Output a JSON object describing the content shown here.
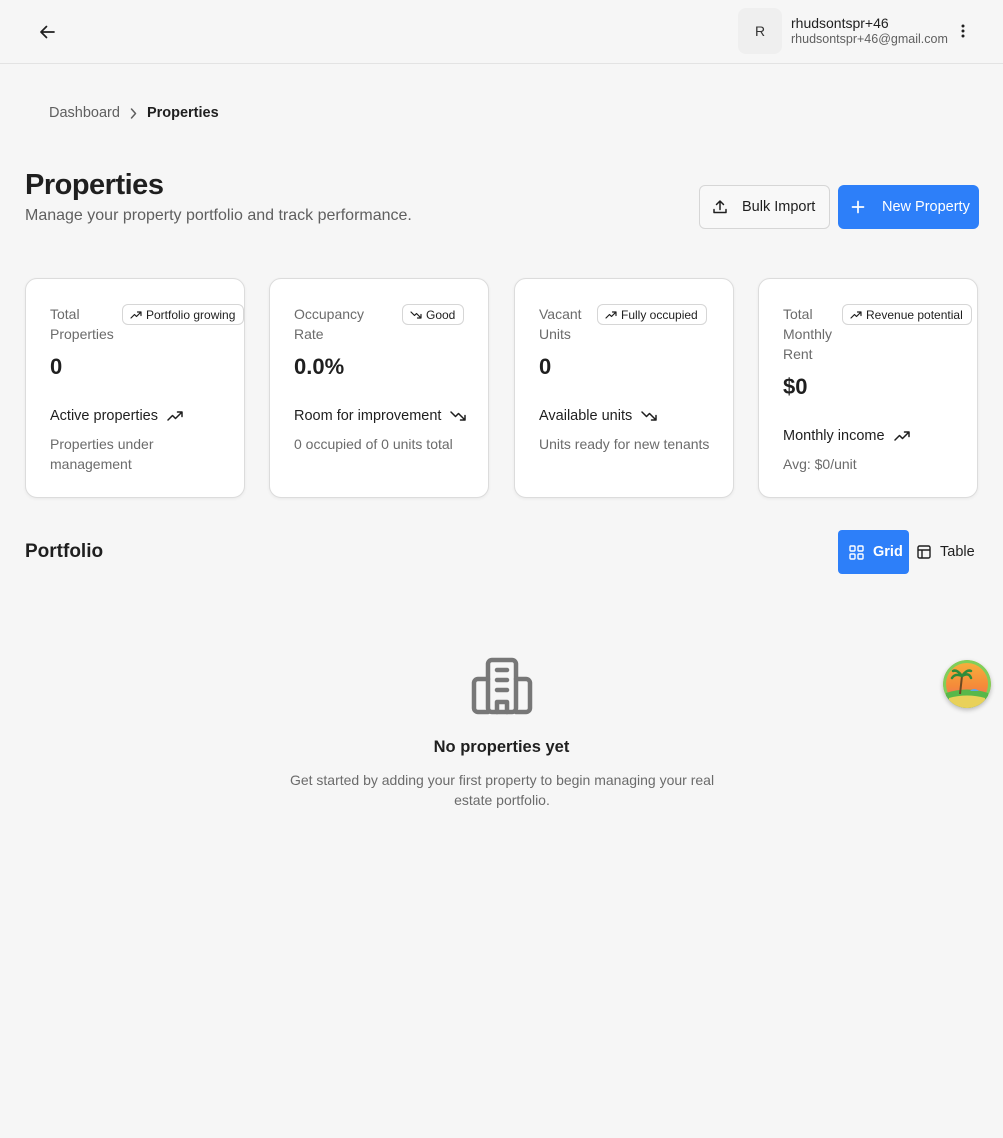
{
  "header": {
    "avatar_initial": "R",
    "user_name": "rhudsontspr+46",
    "user_email": "rhudsontspr+46@gmail.com"
  },
  "breadcrumb": {
    "parent": "Dashboard",
    "current": "Properties"
  },
  "page": {
    "title": "Properties",
    "subtitle": "Manage your property portfolio and track performance."
  },
  "actions": {
    "bulk_import": "Bulk Import",
    "new_property": "New Property"
  },
  "stats": [
    {
      "label_lines": [
        "Total",
        "Properties"
      ],
      "badge": "Portfolio growing",
      "badge_trend": "up",
      "value": "0",
      "footer": "Active properties",
      "footer_trend": "up",
      "sub_lines": [
        "Properties under",
        "management"
      ]
    },
    {
      "label_lines": [
        "Occupancy",
        "Rate"
      ],
      "badge": "Good",
      "badge_trend": "down",
      "value": "0.0%",
      "footer": "Room for improvement",
      "footer_trend": "down",
      "sub_lines": [
        "0 occupied of 0 units total"
      ]
    },
    {
      "label_lines": [
        "Vacant",
        "Units"
      ],
      "badge": "Fully occupied",
      "badge_trend": "up",
      "value": "0",
      "footer": "Available units",
      "footer_trend": "down",
      "sub_lines": [
        "Units ready for new tenants"
      ]
    },
    {
      "label_lines": [
        "Total",
        "Monthly",
        "Rent"
      ],
      "badge": "Revenue potential",
      "badge_trend": "up",
      "value": "$0",
      "footer": "Monthly income",
      "footer_trend": "up",
      "sub_lines": [
        "Avg: $0/unit"
      ]
    }
  ],
  "portfolio": {
    "title": "Portfolio",
    "view_grid": "Grid",
    "view_table": "Table",
    "selected_view": "Grid"
  },
  "empty_state": {
    "icon": "building-icon",
    "title": "No properties yet",
    "description_lines": [
      "Get started by adding your first property to begin managing your real",
      "estate portfolio."
    ]
  },
  "colors": {
    "accent": "#2d7ff9",
    "background": "#f6f6f6",
    "card": "#ffffff"
  }
}
